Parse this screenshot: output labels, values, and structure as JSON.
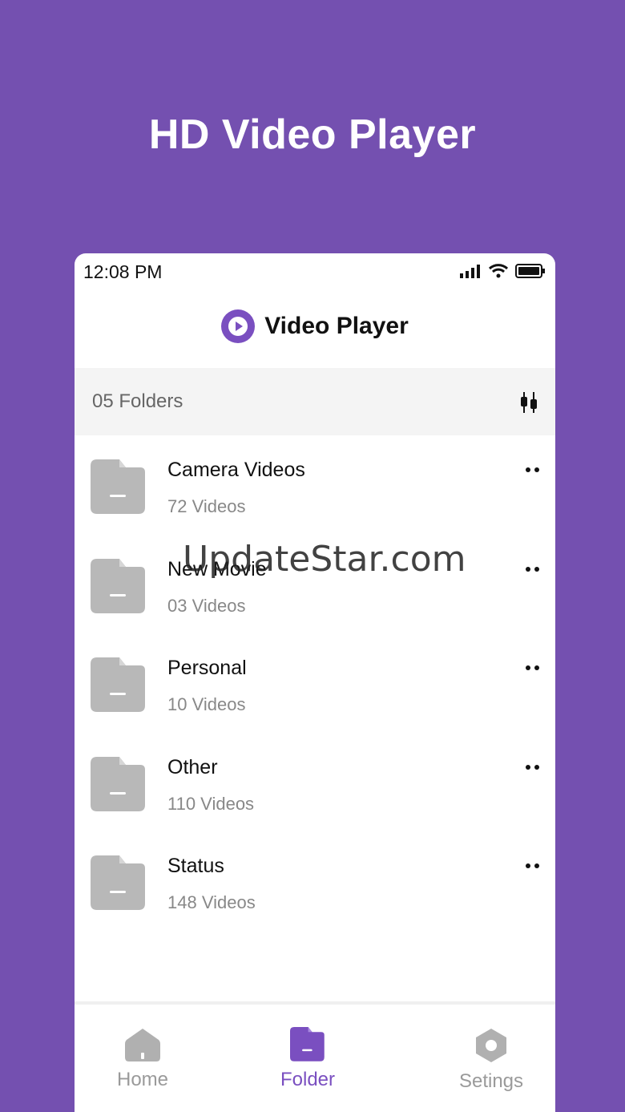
{
  "promo": {
    "title": "HD Video Player"
  },
  "status_bar": {
    "time": "12:08 PM"
  },
  "app": {
    "title": "Video Player"
  },
  "folders_bar": {
    "count_label": "05 Folders"
  },
  "folders": [
    {
      "name": "Camera Videos",
      "count": "72 Videos"
    },
    {
      "name": "New Movie",
      "count": "03 Videos"
    },
    {
      "name": "Personal",
      "count": "10 Videos"
    },
    {
      "name": "Other",
      "count": "110 Videos"
    },
    {
      "name": "Status",
      "count": "148 Videos"
    }
  ],
  "watermark": "UpdateStar.com",
  "nav": {
    "home": "Home",
    "folder": "Folder",
    "settings": "Setings"
  },
  "colors": {
    "brand": "#7450b0",
    "accent": "#7a4fc0",
    "inactive": "#b0b0b0"
  }
}
